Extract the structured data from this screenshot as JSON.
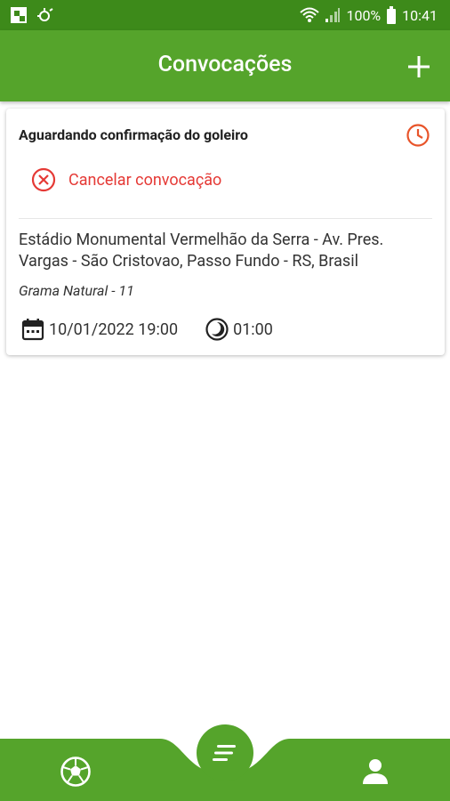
{
  "status_bar": {
    "battery": "100%",
    "time": "10:41"
  },
  "app_bar": {
    "title": "Convocações"
  },
  "card": {
    "status": "Aguardando confirmação do goleiro",
    "cancel_label": "Cancelar convocação",
    "address": "Estádio Monumental Vermelhão da Serra - Av. Pres. Vargas - São Cristovao, Passo Fundo - RS, Brasil",
    "field": "Grama Natural - 11",
    "datetime": "10/01/2022 19:00",
    "duration": "01:00"
  },
  "colors": {
    "primary": "#55a42b",
    "status_bar": "#3d8a1a",
    "danger": "#e53935"
  },
  "bottom_nav": {
    "items": [
      "soccer-ball-icon",
      "list-icon",
      "user-icon"
    ]
  }
}
